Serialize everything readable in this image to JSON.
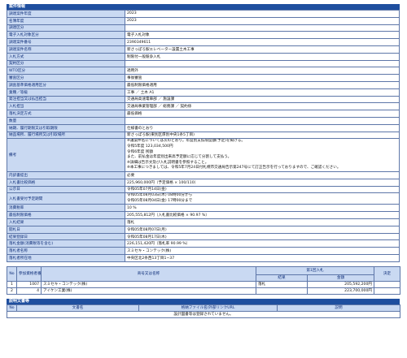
{
  "sections": {
    "case_info_title": "案件情報",
    "design_docs_title": "説明文書等"
  },
  "case_info": [
    {
      "label": "調達案件年度",
      "value": "2023"
    },
    {
      "label": "名簿年度",
      "value": "2023"
    },
    {
      "label": "調達区分",
      "value": ""
    },
    {
      "label": "電子入札対象区分",
      "value": "電子入札対象"
    },
    {
      "label": "調達案件番号",
      "value": "2390349611"
    },
    {
      "label": "調達案件名称",
      "value": "新さっぽろ駅エレベーター設置土木工事"
    },
    {
      "label": "入札方式",
      "value": "制限付一般競争入札"
    },
    {
      "label": "契約区分",
      "value": ""
    },
    {
      "label": "WTO区分",
      "value": "適用外"
    },
    {
      "label": "審査区分",
      "value": "事後審査"
    },
    {
      "label": "調査基準価格適用区分",
      "value": "最低制限価格適用"
    },
    {
      "label": "業種／等級",
      "value": "工事 ／ 土木 A1"
    },
    {
      "label": "発注担当又は払出担当",
      "value": "交通局高速電車部 ／ 施設課"
    },
    {
      "label": "入札担当",
      "value": "交通局事業管理部 ／ 総務課 ／ 契約係"
    },
    {
      "label": "落札決定方式",
      "value": "最低価格"
    },
    {
      "label": "数量",
      "value": ""
    },
    {
      "label": "納期、履行期限又は引取期限",
      "value": "仕様書のとおり"
    },
    {
      "label": "納品場所、履行場所又は引取場所",
      "value": "新さっぽろ駅(東別区厚別中央1条5丁目)"
    },
    {
      "label": "備考",
      "value": "※議案件名については次のとおり。年度別支払限度額(予定)を掲げる。\n令和5年度 123,034,500円\n令和6年度 残額\nまた、前払金は年度別出来高予定額に応じて分割して支払う。\n※詳細は告示文及び入札説明書を参照すること。\n※本工事につきましては、令和5年7月24日付札幌市交通局告示第247号にて訂正告示を行っておりますので、ご確認ください。",
      "tall": true
    },
    {
      "label": "内訳書提出",
      "value": "必要"
    },
    {
      "label": "入札書比較価格",
      "value": "225,960,000円（予定価格 × 100/110）"
    },
    {
      "label": "公示日",
      "value": "令和05年07月14日(金)"
    },
    {
      "label": "入札書受付予定期間",
      "value": "令和05年08月03日(木) 08時00分から\n令和05年08月04日(金) 17時00分まで",
      "two": true
    },
    {
      "label": "消費税率",
      "value": "10 %"
    },
    {
      "label": "最低制限価格",
      "value": "205,555,812円（入札書比較価格 × 90.97 %）"
    },
    {
      "label": "入札結果",
      "value": "落札"
    },
    {
      "label": "開札日",
      "value": "令和05年08月07日(月)"
    },
    {
      "label": "結果登録日",
      "value": "令和05年08月17日(木)"
    },
    {
      "label": "落札金額(消費税等を含む)",
      "value": "226,151,420円（落札率 90.99 %）"
    },
    {
      "label": "落札者名称",
      "value": "スミセキ・コンテック(株)"
    },
    {
      "label": "落札者所在地",
      "value": "中央区北2条西13丁目1−37"
    }
  ],
  "results_table": {
    "headers": {
      "no": "No",
      "bidders": "参加資格者番号",
      "name": "商号又は名称",
      "round1": "第1回入札",
      "result": "結果",
      "amount": "金額",
      "decision": "決定"
    },
    "rows": [
      {
        "no": "1",
        "bidder_no": "1007",
        "name": "スミセキ・コンテック(株)",
        "result": "落札",
        "amount": "205,592,200円",
        "decision": ""
      },
      {
        "no": "2",
        "bidder_no": "4",
        "name": "アイケン工業(株)",
        "result": "",
        "amount": "223,700,000円",
        "decision": ""
      }
    ]
  },
  "docs_table": {
    "headers": {
      "no": "No",
      "doc_name": "文書名",
      "file": "格納ファイル名/外部リンクURL",
      "note": "説明"
    },
    "empty_message": "設計図書等は登録されていません。"
  },
  "colors": {
    "header_bg": "#1f4f9f",
    "label_bg": "#c9d9f2",
    "border": "#5d76a8"
  }
}
